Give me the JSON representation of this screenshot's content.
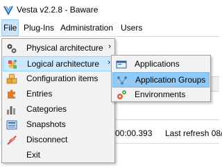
{
  "window": {
    "title": "Vesta v2.2.8 - Baware"
  },
  "menubar": {
    "items": [
      {
        "label": "File"
      },
      {
        "label": "Plug-Ins"
      },
      {
        "label": "Administration"
      },
      {
        "label": "Users"
      }
    ]
  },
  "file_menu": {
    "items": [
      {
        "label": "Physical architecture",
        "icon": "gears-icon",
        "has_submenu": true
      },
      {
        "label": "Logical architecture",
        "icon": "palette-icon",
        "has_submenu": true
      },
      {
        "label": "Configuration items",
        "icon": "boxes-icon"
      },
      {
        "label": "Entries",
        "icon": "puzzle-icon"
      },
      {
        "label": "Categories",
        "icon": "bar-chart-icon"
      },
      {
        "label": "Snapshots",
        "icon": "snapshot-icon"
      },
      {
        "label": "Disconnect",
        "icon": "disconnect-icon"
      },
      {
        "label": "Exit",
        "icon": ""
      }
    ],
    "submenu_arrow": "›"
  },
  "logical_submenu": {
    "items": [
      {
        "label": "Applications",
        "icon": "application-window-icon"
      },
      {
        "label": "Application Groups",
        "icon": "application-group-icon"
      },
      {
        "label": "Environments",
        "icon": "environment-gear-icon"
      }
    ]
  },
  "background": {
    "elapsed": "00:00.393",
    "last_refresh": "Last refresh 08/"
  },
  "colors": {
    "menu_highlight": "#cce8ff",
    "submenu_highlight": "#91c9f7"
  }
}
